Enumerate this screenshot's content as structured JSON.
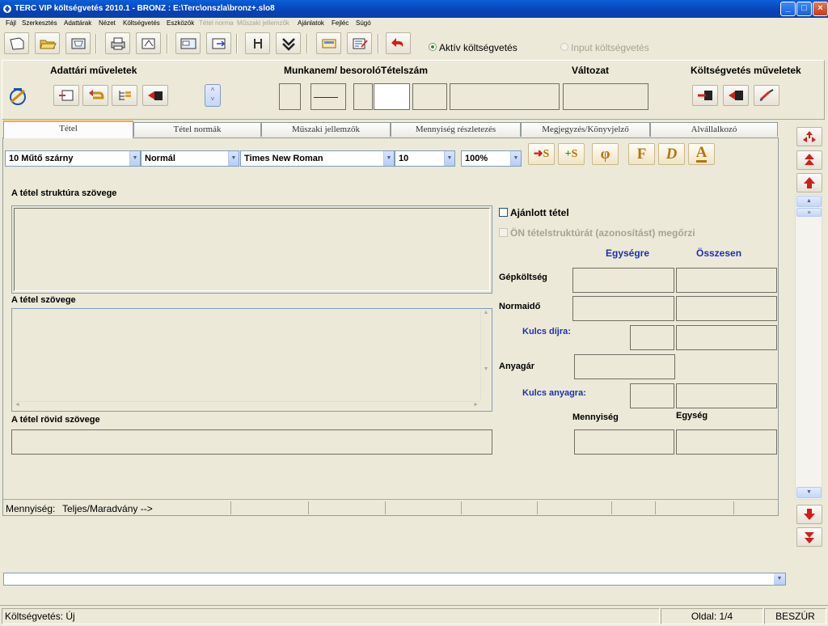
{
  "window": {
    "title": "TERC VIP költségvetés 2010.1 - BRONZ :  E:\\Terc\\onszla\\bronz+.slo8",
    "minimize": "_",
    "maximize": "□",
    "close": "×"
  },
  "menu": [
    {
      "label": "Fájl",
      "enabled": true
    },
    {
      "label": "Szerkesztés",
      "enabled": true
    },
    {
      "label": "Adattárak",
      "enabled": true
    },
    {
      "label": "Nézet",
      "enabled": true
    },
    {
      "label": "Költségvetés",
      "enabled": true
    },
    {
      "label": "Eszközök",
      "enabled": true
    },
    {
      "label": "Tétel norma",
      "enabled": false
    },
    {
      "label": "Műszaki jellemzők",
      "enabled": false
    },
    {
      "label": "Ajánlatok",
      "enabled": true
    },
    {
      "label": "Fejléc",
      "enabled": true
    },
    {
      "label": "Súgó",
      "enabled": true
    }
  ],
  "mode": {
    "active_label": "Aktív költségvetés",
    "input_label": "Input költségvetés"
  },
  "header": {
    "adattari_label": "Adattári műveletek",
    "munkanem_label": "Munkanem/ besoroló",
    "tetelszam_label": "Tételszám",
    "valtozat_label": "Változat",
    "koltsegvetes_ops_label": "Költségvetés műveletek"
  },
  "tabs": [
    {
      "label": "Tétel",
      "active": true
    },
    {
      "label": "Tétel normák",
      "active": false
    },
    {
      "label": "Műszaki jellemzők",
      "active": false
    },
    {
      "label": "Mennyiség részletezés",
      "active": false
    },
    {
      "label": "Megjegyzés/Könyvjelző",
      "active": false
    },
    {
      "label": "Alvállalkozó",
      "active": false
    }
  ],
  "format": {
    "style_value": "10 Műtő szárny",
    "paragraph_value": "Normál",
    "font_value": "Times New Roman",
    "size_value": "10",
    "zoom_value": "100%",
    "btn_f": "F",
    "btn_d": "D",
    "btn_a": "A",
    "btn_phi": "φ",
    "btn_s1": "S",
    "btn_s2": "S"
  },
  "tetel": {
    "struktura_label": "A tétel struktúra szövege",
    "szoveg_label": "A tétel szövege",
    "rovid_label": "A tétel rövid szövege",
    "ajanlott_label": "Ajánlott tétel",
    "on_label": "ÖN tételstruktúrát (azonosítást) megőrzi",
    "egysegre_label": "Egységre",
    "osszesen_label": "Összesen",
    "gepkoltseg_label": "Gépköltség",
    "normaido_label": "Normaidő",
    "kulcs_dijra_label": "Kulcs díjra:",
    "anyagar_label": "Anyagár",
    "kulcs_anyagra_label": "Kulcs anyagra:",
    "mennyiseg_label": "Mennyiség",
    "egyseg_label": "Egység"
  },
  "quantity_row": {
    "label": "Mennyiség:",
    "value": "Teljes/Maradvány -->"
  },
  "statusbar": {
    "koltsegvetes": "Költségvetés: Új",
    "oldal": "Oldal: 1/4",
    "mode": "BESZÚR"
  }
}
